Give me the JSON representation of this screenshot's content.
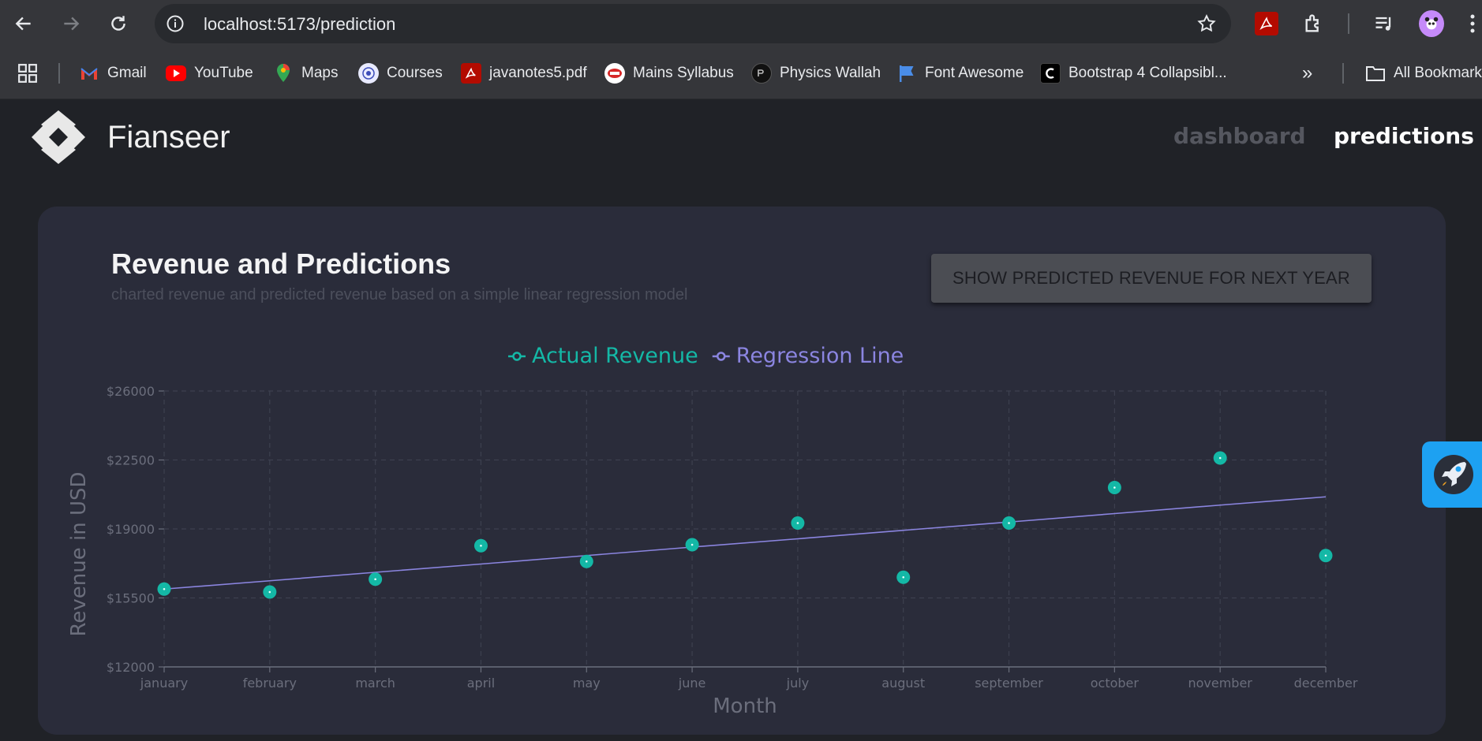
{
  "browser": {
    "url_host": "localhost",
    "url_path": ":5173/prediction",
    "bookmarks": [
      {
        "label": "Gmail",
        "icon": "gmail-icon"
      },
      {
        "label": "YouTube",
        "icon": "youtube-icon"
      },
      {
        "label": "Maps",
        "icon": "maps-icon"
      },
      {
        "label": "Courses",
        "icon": "courses-icon"
      },
      {
        "label": "javanotes5.pdf",
        "icon": "pdf-icon"
      },
      {
        "label": "Mains Syllabus",
        "icon": "syllabus-icon"
      },
      {
        "label": "Physics Wallah",
        "icon": "pw-icon"
      },
      {
        "label": "Font Awesome",
        "icon": "flag-icon"
      },
      {
        "label": "Bootstrap 4 Collapsibl...",
        "icon": "codepen-icon"
      }
    ],
    "more_bookmarks_label": "»",
    "all_bookmarks_label": "All Bookmarks"
  },
  "app": {
    "brand": "Fianseer",
    "nav": [
      {
        "label": "dashboard",
        "active": false
      },
      {
        "label": "predictions",
        "active": true
      }
    ]
  },
  "card": {
    "title": "Revenue and Predictions",
    "subtitle": "charted revenue and predicted revenue based on a simple linear regression model",
    "button_label": "SHOW PREDICTED REVENUE FOR NEXT YEAR"
  },
  "colors": {
    "actual": "#14b8a6",
    "regression": "#8b85e0",
    "grid": "#3d404f",
    "axis_text": "#6b6e7c",
    "nav_inactive": "#55575f",
    "nav_active": "#ffffff"
  },
  "chart_data": {
    "type": "scatter",
    "categories": [
      "january",
      "february",
      "march",
      "april",
      "may",
      "june",
      "july",
      "august",
      "september",
      "october",
      "november",
      "december"
    ],
    "series": [
      {
        "name": "Actual Revenue",
        "kind": "scatter",
        "values": [
          15950,
          15800,
          16450,
          18150,
          17350,
          18200,
          19300,
          16550,
          19300,
          21100,
          22600,
          17650
        ]
      },
      {
        "name": "Regression Line",
        "kind": "line",
        "values": [
          15950,
          16370,
          16800,
          17220,
          17650,
          18080,
          18500,
          18930,
          19350,
          19780,
          20210,
          20630
        ]
      }
    ],
    "xlabel": "Month",
    "ylabel": "Revenue in USD",
    "yticks": [
      12000,
      15500,
      19000,
      22500,
      26000
    ],
    "ytick_prefix": "$",
    "ylim": [
      12000,
      26000
    ],
    "grid": true,
    "legend_position": "top-center"
  }
}
